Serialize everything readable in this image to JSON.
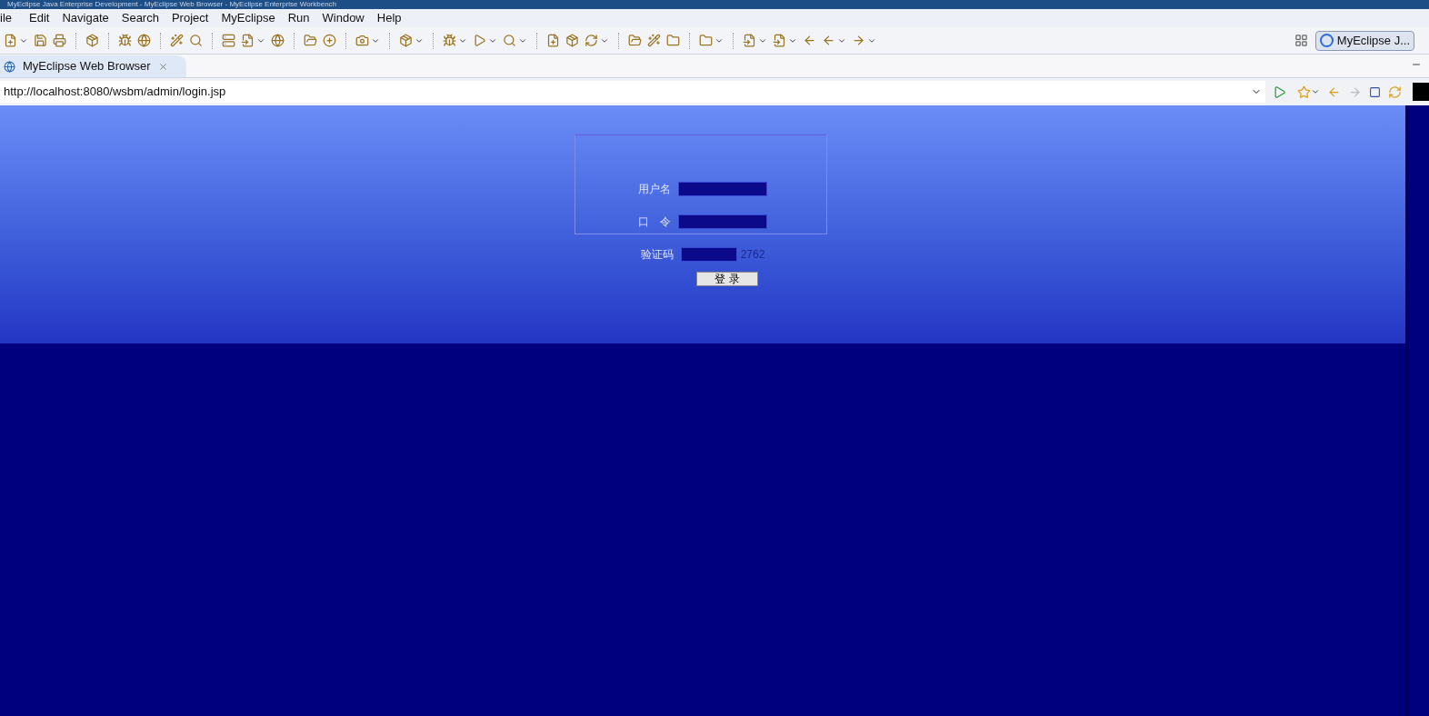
{
  "window": {
    "title": "MyEclipse Java Enterprise Development - MyEclipse Web Browser - MyEclipse Enterprise Workbench"
  },
  "menu": [
    "ile",
    "Edit",
    "Navigate",
    "Search",
    "Project",
    "MyEclipse",
    "Run",
    "Window",
    "Help"
  ],
  "perspective": {
    "label": "MyEclipse J..."
  },
  "tabs": [
    {
      "label": "MyEclipse Web Browser",
      "selected": true
    }
  ],
  "address": {
    "value": "http://localhost:8080/wsbm/admin/login.jsp"
  },
  "login": {
    "fields": [
      {
        "label": "用户名",
        "kind": "text"
      },
      {
        "label": "口　令",
        "kind": "password"
      },
      {
        "label": "验证码",
        "kind": "captcha",
        "code": "2762"
      }
    ],
    "button": "登 录"
  }
}
